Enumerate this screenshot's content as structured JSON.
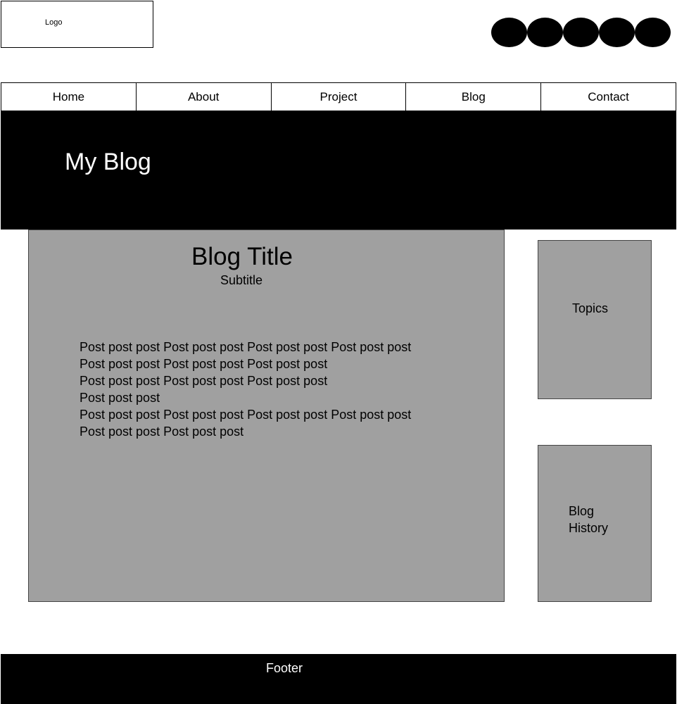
{
  "header": {
    "logo_label": "Logo",
    "social_icons": [
      "social-icon-1",
      "social-icon-2",
      "social-icon-3",
      "social-icon-4",
      "social-icon-5"
    ]
  },
  "nav": {
    "items": [
      {
        "label": "Home"
      },
      {
        "label": "About"
      },
      {
        "label": "Project"
      },
      {
        "label": "Blog"
      },
      {
        "label": "Contact"
      }
    ]
  },
  "hero": {
    "title": "My Blog"
  },
  "post": {
    "title": "Blog Title",
    "subtitle": "Subtitle",
    "lines": [
      "Post post post Post post post Post post post Post post post",
      "Post post post Post post post Post post post",
      "Post post post Post post post Post post post",
      "Post post post",
      "Post post post Post post post Post post post Post post post",
      "Post post post Post post post"
    ]
  },
  "sidebar": {
    "topics_label": "Topics",
    "history_label": "Blog History"
  },
  "footer": {
    "label": "Footer"
  },
  "colors": {
    "content_bg": "#a0a0a0",
    "dark_band": "#000000",
    "page_bg": "#ffffff"
  }
}
